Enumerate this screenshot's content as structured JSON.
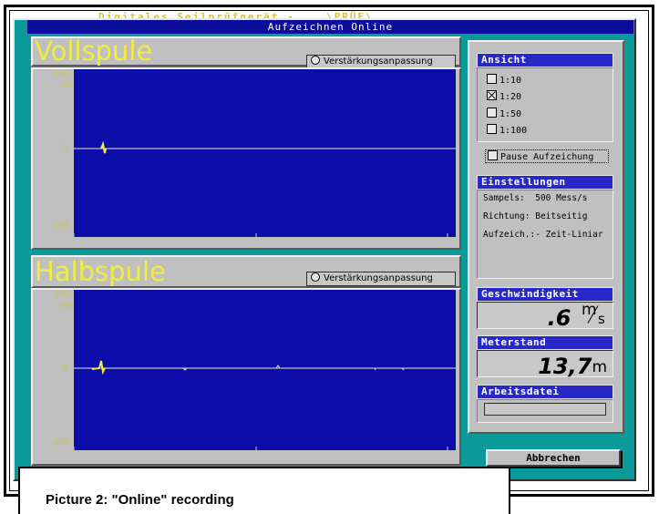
{
  "background_window_title": "Digitales Seilprüfgerät - ...\\PRÜF\\...",
  "window": {
    "title": "Aufzeichnen Online"
  },
  "channels": [
    {
      "title": "Vollspule",
      "gain_option": "Verstärkungsanpassung",
      "y_max": "200",
      "y_zero": "0",
      "y_min": "-200",
      "unit": "mV"
    },
    {
      "title": "Halbspule",
      "gain_option": "Verstärkungsanpassung",
      "y_max": "200",
      "y_zero": "0",
      "y_min": "-200",
      "unit": "mV"
    }
  ],
  "view": {
    "heading": "Ansicht",
    "options": [
      {
        "label": "1:10",
        "checked": false
      },
      {
        "label": "1:20",
        "checked": true
      },
      {
        "label": "1:50",
        "checked": false
      },
      {
        "label": "1:100",
        "checked": false
      }
    ]
  },
  "pause_label": "Pause Aufzeichung",
  "settings": {
    "heading": "Einstellungen",
    "rows": [
      {
        "key": "Sampels:",
        "value": "500 Mess/s"
      },
      {
        "key": "Richtung:",
        "value": "Beitseitig"
      },
      {
        "key": "Aufzeich.:-",
        "value": "Zeit-Liniar"
      }
    ]
  },
  "speed": {
    "heading": "Geschwindigkeit",
    "value": ".6",
    "unit_num": "m",
    "unit_den": "s"
  },
  "meter": {
    "heading": "Meterstand",
    "value": "13,7",
    "unit": "m"
  },
  "workfile": {
    "heading": "Arbeitsdatei",
    "value": ""
  },
  "abort_label": "Abbrechen",
  "caption": "Picture 2: \"Online\" recording",
  "colors": {
    "plot_bg": "#0c0ca8",
    "trace": "#e8e8c8",
    "title_yellow": "#f2ee3e",
    "window_teal": "#0a9a9a",
    "heading_blue": "#2828c8"
  }
}
